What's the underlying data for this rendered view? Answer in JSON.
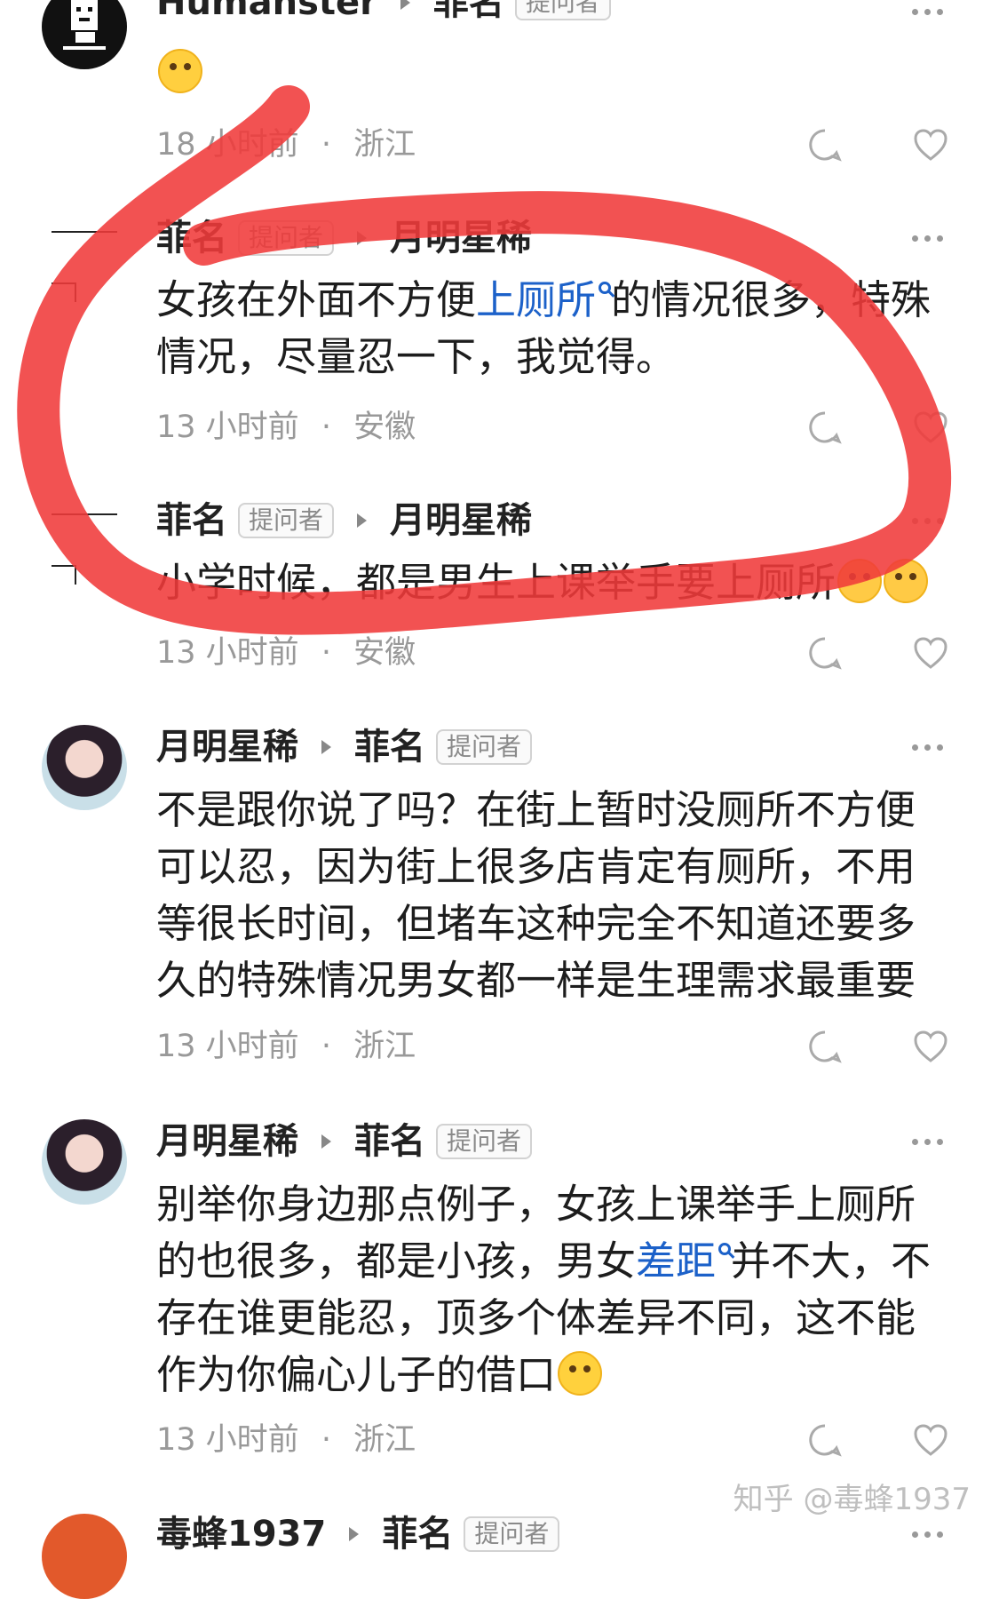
{
  "comments": [
    {
      "author": "Humanster",
      "target": "菲名",
      "target_badge": "提问者",
      "time": "18 小时前",
      "location": "浙江",
      "emoji": "sweat-smile-emoji"
    },
    {
      "author": "菲名",
      "author_badge": "提问者",
      "target": "月明星稀",
      "text_before": "女孩在外面不方便",
      "link": "上厕所",
      "text_line1_after": "的情况很多，特殊",
      "text_line2": "情况，尽量忍一下，我觉得。",
      "time": "13 小时前",
      "location": "安徽"
    },
    {
      "author": "菲名",
      "author_badge": "提问者",
      "target": "月明星稀",
      "text": "小学时候，都是男生上课举手要上厕所",
      "emoji": "loudly-crying-emoji",
      "time": "13 小时前",
      "location": "安徽"
    },
    {
      "author": "月明星稀",
      "target": "菲名",
      "target_badge": "提问者",
      "lines": [
        "不是跟你说了吗？在街上暂时没厕所不方便",
        "可以忍，因为街上很多店肯定有厕所，不用",
        "等很长时间，但堵车这种完全不知道还要多",
        "久的特殊情况男女都一样是生理需求最重要"
      ],
      "time": "13 小时前",
      "location": "浙江"
    },
    {
      "author": "月明星稀",
      "target": "菲名",
      "target_badge": "提问者",
      "line1": "别举你身边那点例子，女孩上课举手上厕所",
      "line2_before": "的也很多，都是小孩，男女",
      "line2_link": "差距",
      "line2_after": "并不大，不",
      "line3": "存在谁更能忍，顶多个体差异不同，这不能",
      "line4": "作为你偏心儿子的借口",
      "emoji": "rolling-laughing-emoji",
      "time": "13 小时前",
      "location": "浙江"
    },
    {
      "author": "毒蜂1937",
      "target": "菲名",
      "target_badge": "提问者"
    }
  ],
  "watermark": "知乎 @毒蜂1937",
  "separator": "·",
  "colors": {
    "annotation_red": "#f03a3a",
    "link_blue": "#1c61c9"
  }
}
